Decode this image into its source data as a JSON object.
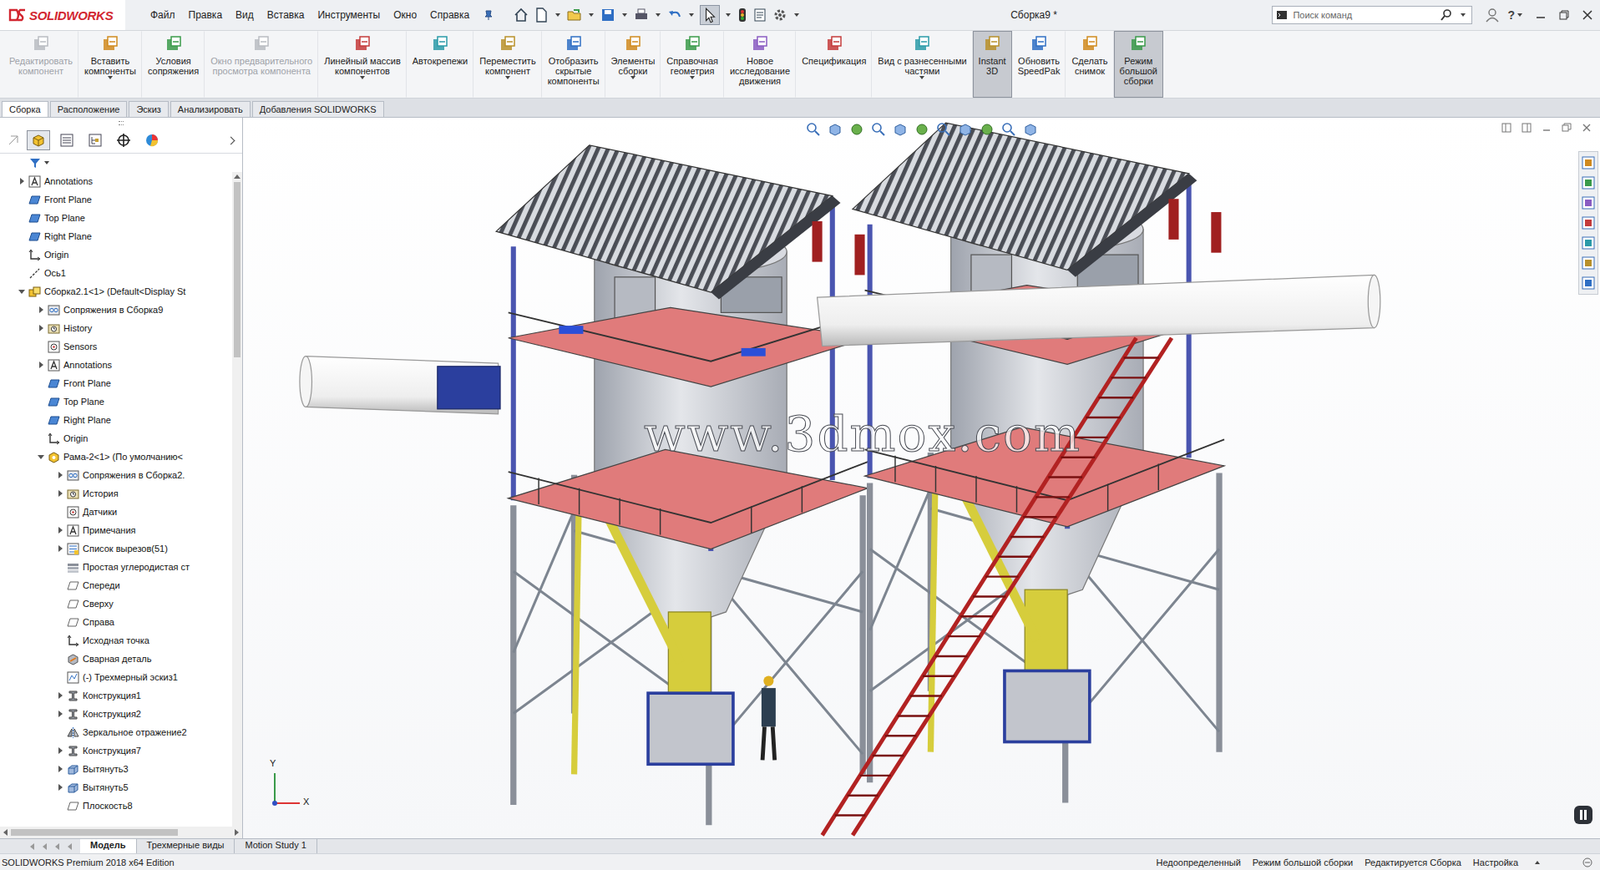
{
  "window": {
    "app": "SOLIDWORKS",
    "title": "Сборка9 *",
    "help": "?"
  },
  "menu": [
    "Файл",
    "Правка",
    "Вид",
    "Вставка",
    "Инструменты",
    "Окно",
    "Справка"
  ],
  "search": {
    "placeholder": "Поиск команд"
  },
  "ribbon": [
    {
      "lines": [
        "Редактировать",
        "компонент"
      ],
      "disabled": true,
      "selected": false,
      "dropdown": false
    },
    {
      "lines": [
        "Вставить",
        "компоненты"
      ],
      "disabled": false,
      "selected": false,
      "dropdown": true
    },
    {
      "lines": [
        "Условия",
        "сопряжения"
      ],
      "disabled": false,
      "selected": false,
      "dropdown": false
    },
    {
      "lines": [
        "Окно предварительного",
        "просмотра компонента"
      ],
      "disabled": true,
      "selected": false,
      "dropdown": false
    },
    {
      "lines": [
        "Линейный массив",
        "компонентов"
      ],
      "disabled": false,
      "selected": false,
      "dropdown": true
    },
    {
      "lines": [
        "Автокрепежи"
      ],
      "disabled": false,
      "selected": false,
      "dropdown": false
    },
    {
      "lines": [
        "Переместить",
        "компонент"
      ],
      "disabled": false,
      "selected": false,
      "dropdown": true
    },
    {
      "lines": [
        "Отобразить",
        "скрытые",
        "компоненты"
      ],
      "disabled": false,
      "selected": false,
      "dropdown": false
    },
    {
      "lines": [
        "Элементы",
        "сборки"
      ],
      "disabled": false,
      "selected": false,
      "dropdown": true
    },
    {
      "lines": [
        "Справочная",
        "геометрия"
      ],
      "disabled": false,
      "selected": false,
      "dropdown": true
    },
    {
      "lines": [
        "Новое",
        "исследование",
        "движения"
      ],
      "disabled": false,
      "selected": false,
      "dropdown": false
    },
    {
      "lines": [
        "Спецификация"
      ],
      "disabled": false,
      "selected": false,
      "dropdown": false
    },
    {
      "lines": [
        "Вид с разнесенными",
        "частями"
      ],
      "disabled": false,
      "selected": false,
      "dropdown": true
    },
    {
      "lines": [
        "Instant",
        "3D"
      ],
      "disabled": false,
      "selected": true,
      "dropdown": false
    },
    {
      "lines": [
        "Обновить",
        "SpeedPak"
      ],
      "disabled": false,
      "selected": false,
      "dropdown": false
    },
    {
      "lines": [
        "Сделать",
        "снимок"
      ],
      "disabled": false,
      "selected": false,
      "dropdown": false
    },
    {
      "lines": [
        "Режим",
        "большой",
        "сборки"
      ],
      "disabled": false,
      "selected": true,
      "dropdown": false
    }
  ],
  "tabs": [
    {
      "label": "Сборка",
      "selected": true
    },
    {
      "label": "Расположение",
      "selected": false
    },
    {
      "label": "Эскиз",
      "selected": false
    },
    {
      "label": "Анализировать",
      "selected": false
    },
    {
      "label": "Добавления SOLIDWORKS",
      "selected": false
    }
  ],
  "panel_tabs": [
    {
      "kind": "feature-manager",
      "selected": true
    },
    {
      "kind": "property-manager",
      "selected": false
    },
    {
      "kind": "configuration-manager",
      "selected": false
    },
    {
      "kind": "dimxpert-manager",
      "selected": false
    },
    {
      "kind": "display-manager",
      "selected": false
    }
  ],
  "tree": {
    "items": [
      {
        "label": "Annotations",
        "depth": 0,
        "kind": "annotations",
        "expander": "collapsed"
      },
      {
        "label": "Front Plane",
        "depth": 0,
        "kind": "plane",
        "expander": "none"
      },
      {
        "label": "Top Plane",
        "depth": 0,
        "kind": "plane",
        "expander": "none"
      },
      {
        "label": "Right Plane",
        "depth": 0,
        "kind": "plane",
        "expander": "none"
      },
      {
        "label": "Origin",
        "depth": 0,
        "kind": "origin",
        "expander": "none"
      },
      {
        "label": "Ось1",
        "depth": 0,
        "kind": "axis",
        "expander": "none"
      },
      {
        "label": "Сборка2.1<1> (Default<Display St",
        "depth": 0,
        "kind": "assembly",
        "expander": "expanded"
      },
      {
        "label": "Сопряжения в Сборка9",
        "depth": 1,
        "kind": "mates",
        "expander": "collapsed"
      },
      {
        "label": "History",
        "depth": 1,
        "kind": "history",
        "expander": "collapsed"
      },
      {
        "label": "Sensors",
        "depth": 1,
        "kind": "sensor",
        "expander": "none"
      },
      {
        "label": "Annotations",
        "depth": 1,
        "kind": "annotations",
        "expander": "collapsed"
      },
      {
        "label": "Front Plane",
        "depth": 1,
        "kind": "plane",
        "expander": "none"
      },
      {
        "label": "Top Plane",
        "depth": 1,
        "kind": "plane",
        "expander": "none"
      },
      {
        "label": "Right Plane",
        "depth": 1,
        "kind": "plane",
        "expander": "none"
      },
      {
        "label": "Origin",
        "depth": 1,
        "kind": "origin",
        "expander": "none"
      },
      {
        "label": "Рама-2<1> (По умолчанию<",
        "depth": 1,
        "kind": "part",
        "expander": "expanded"
      },
      {
        "label": "Сопряжения в Сборка2.",
        "depth": 2,
        "kind": "mates",
        "expander": "collapsed"
      },
      {
        "label": "История",
        "depth": 2,
        "kind": "history",
        "expander": "collapsed"
      },
      {
        "label": "Датчики",
        "depth": 2,
        "kind": "sensor",
        "expander": "none"
      },
      {
        "label": "Примечания",
        "depth": 2,
        "kind": "annotations",
        "expander": "collapsed"
      },
      {
        "label": "Список вырезов(51)",
        "depth": 2,
        "kind": "cutlist",
        "expander": "collapsed"
      },
      {
        "label": "Простая углеродистая ст",
        "depth": 2,
        "kind": "material",
        "expander": "none"
      },
      {
        "label": "Спереди",
        "depth": 2,
        "kind": "plane-outline",
        "expander": "none"
      },
      {
        "label": "Сверху",
        "depth": 2,
        "kind": "plane-outline",
        "expander": "none"
      },
      {
        "label": "Справа",
        "depth": 2,
        "kind": "plane-outline",
        "expander": "none"
      },
      {
        "label": "Исходная точка",
        "depth": 2,
        "kind": "origin",
        "expander": "none"
      },
      {
        "label": "Сварная деталь",
        "depth": 2,
        "kind": "weldment",
        "expander": "none"
      },
      {
        "label": "(-) Трехмерный эскиз1",
        "depth": 2,
        "kind": "sketch3d",
        "expander": "none"
      },
      {
        "label": "Конструкция1",
        "depth": 2,
        "kind": "structural",
        "expander": "collapsed"
      },
      {
        "label": "Конструкция2",
        "depth": 2,
        "kind": "structural",
        "expander": "collapsed"
      },
      {
        "label": "Зеркальное отражение2",
        "depth": 2,
        "kind": "mirror",
        "expander": "none"
      },
      {
        "label": "Конструкция7",
        "depth": 2,
        "kind": "structural",
        "expander": "collapsed"
      },
      {
        "label": "Вытянуть3",
        "depth": 2,
        "kind": "extrude",
        "expander": "collapsed"
      },
      {
        "label": "Вытянуть5",
        "depth": 2,
        "kind": "extrude",
        "expander": "collapsed"
      },
      {
        "label": "Плоскость8",
        "depth": 2,
        "kind": "plane-outline",
        "expander": "none"
      }
    ]
  },
  "watermark": "www.3dmox.com",
  "triad": {
    "y": "Y",
    "x": "X"
  },
  "model_tabs": [
    {
      "label": "Модель",
      "selected": true
    },
    {
      "label": "Трехмерные виды",
      "selected": false
    },
    {
      "label": "Motion Study 1",
      "selected": false
    }
  ],
  "status_bar": {
    "left": "SOLIDWORKS Premium 2018 x64 Edition",
    "right": [
      "Недоопределенный",
      "Режим большой сборки",
      "Редактируется Сборка",
      "Настройка"
    ]
  }
}
